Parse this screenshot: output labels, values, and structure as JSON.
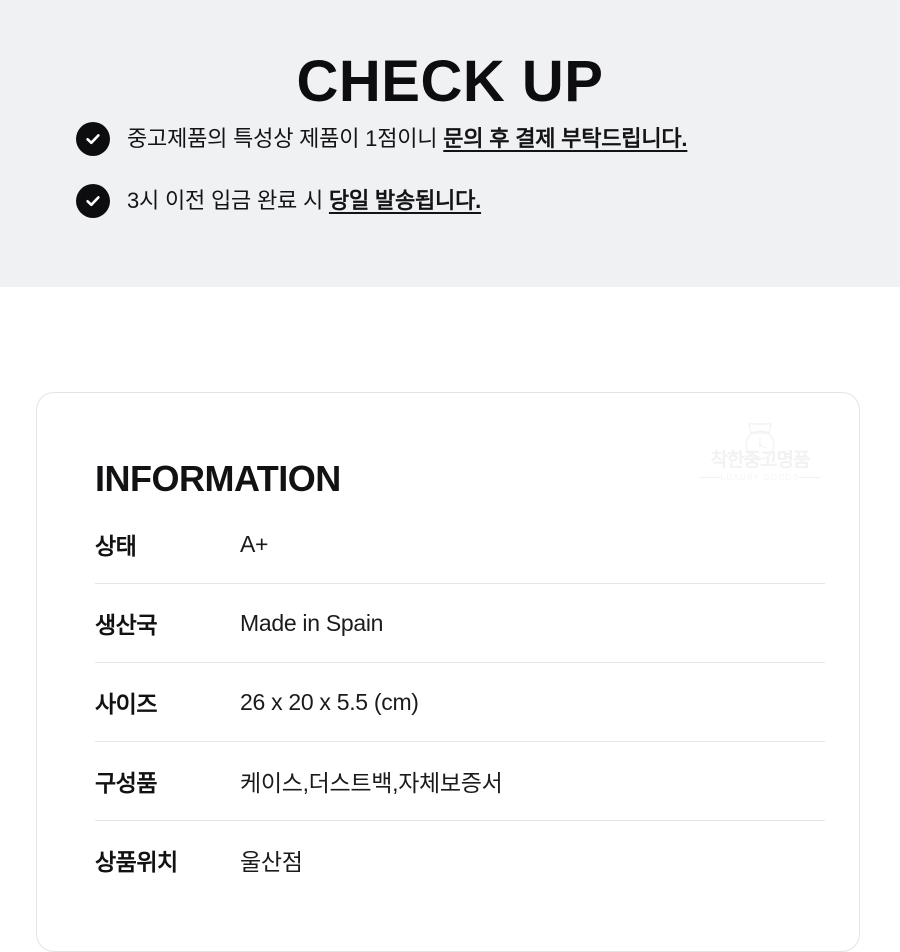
{
  "checkup": {
    "title": "CHECK UP",
    "bullets": [
      {
        "icon": "check-circle-icon",
        "plain": "중고제품의 특성상 제품이 1점이니 ",
        "emphasis": "문의 후 결제 부탁드립니다."
      },
      {
        "icon": "check-circle-icon",
        "plain": "3시 이전 입금 완료 시 ",
        "emphasis": "당일 발송됩니다."
      }
    ]
  },
  "information": {
    "title": "INFORMATION",
    "logo": {
      "mark": "watch-face-icon",
      "name": "착한중고명품",
      "subtitle": "LUXURY GOODS"
    },
    "rows": [
      {
        "label": "상태",
        "value": "A+"
      },
      {
        "label": "생산국",
        "value": "Made in Spain"
      },
      {
        "label": "사이즈",
        "value": "26 x 20 x 5.5 (cm)"
      },
      {
        "label": "구성품",
        "value": "케이스,더스트백,자체보증서"
      },
      {
        "label": "상품위치",
        "value": "울산점"
      }
    ]
  },
  "colors": {
    "band_background": "#f0f1f3",
    "page_background": "#ffffff",
    "text": "#121214",
    "icon_fill": "#0d0d0f",
    "divider": "#e4e5e7",
    "card_border": "#e3e4e6",
    "watermark": "#f2f2f3"
  }
}
